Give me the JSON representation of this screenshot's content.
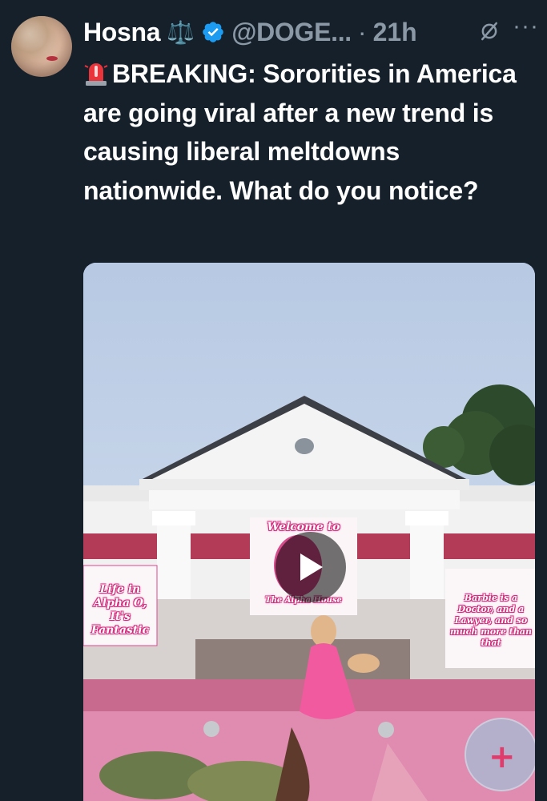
{
  "tweet": {
    "author_name": "Hosna",
    "badge_emoji": "⚖️",
    "handle": "@DOGE...",
    "separator": "·",
    "time": "21h",
    "more_label": "···",
    "siren_icon": "police-light-emoji",
    "text": "BREAKING: Sororities in America are going viral after a new trend is causing liberal meltdowns nationwide. What do you notice?"
  },
  "media": {
    "center_banner": {
      "top": "Welcome to",
      "bottom": "The Alpha House"
    },
    "left_banner": "Life in Alpha O, It's Fantastic",
    "right_banner": "Barbie is a Doctor, and a Lawyer, and so much more than that",
    "play_icon": "play-icon",
    "sticker_icon": "plus-icon"
  },
  "colors": {
    "background": "#15202b",
    "text": "#ffffff",
    "muted": "#8b98a5",
    "verified": "#1d9bf0",
    "pink": "#e0458f"
  }
}
